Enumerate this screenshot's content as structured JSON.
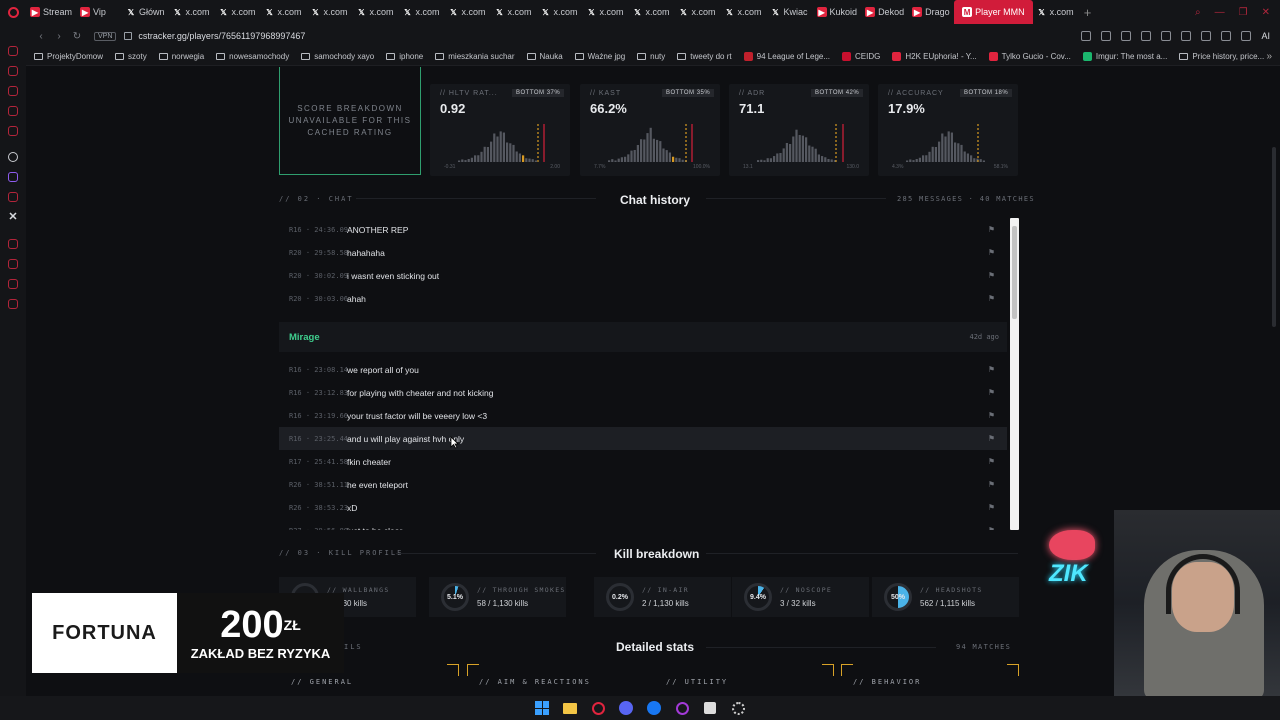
{
  "browser": {
    "tabs": [
      {
        "label": "Stream",
        "color": "#e0243e"
      },
      {
        "label": "Vip",
        "color": "#e0243e"
      },
      {
        "label": "Główn",
        "color": "#cccccc"
      },
      {
        "label": "x.com",
        "color": "#cccccc"
      },
      {
        "label": "x.com",
        "color": "#cccccc"
      },
      {
        "label": "x.com",
        "color": "#cccccc"
      },
      {
        "label": "x.com",
        "color": "#cccccc"
      },
      {
        "label": "x.com",
        "color": "#cccccc"
      },
      {
        "label": "x.com",
        "color": "#cccccc"
      },
      {
        "label": "x.com",
        "color": "#cccccc"
      },
      {
        "label": "x.com",
        "color": "#cccccc"
      },
      {
        "label": "x.com",
        "color": "#cccccc"
      },
      {
        "label": "x.com",
        "color": "#cccccc"
      },
      {
        "label": "x.com",
        "color": "#cccccc"
      },
      {
        "label": "x.com",
        "color": "#cccccc"
      },
      {
        "label": "x.com",
        "color": "#cccccc"
      },
      {
        "label": "Kwiac",
        "color": "#cccccc"
      },
      {
        "label": "Kukoid",
        "color": "#e0243e"
      },
      {
        "label": "Dekod",
        "color": "#e0243e"
      },
      {
        "label": "Drago",
        "color": "#e0243e"
      }
    ],
    "active_tab": "Player MMN",
    "trailing_tab": "x.com",
    "vpn_label": "VPN",
    "url": "cstracker.gg/players/76561197968997467",
    "ai_label": "AI",
    "bookmarks": [
      {
        "label": "ProjektyDomow",
        "kind": "folder"
      },
      {
        "label": "szoty",
        "kind": "folder"
      },
      {
        "label": "norwegia",
        "kind": "folder"
      },
      {
        "label": "nowesamochody",
        "kind": "folder"
      },
      {
        "label": "samochody xayo",
        "kind": "folder"
      },
      {
        "label": "iphone",
        "kind": "folder"
      },
      {
        "label": "mieszkania suchar",
        "kind": "folder"
      },
      {
        "label": "Nauka",
        "kind": "folder"
      },
      {
        "label": "Ważne jpg",
        "kind": "folder"
      },
      {
        "label": "nuty",
        "kind": "folder"
      },
      {
        "label": "tweety do rt",
        "kind": "folder"
      },
      {
        "label": "94 League of Lege...",
        "kind": "site",
        "color": "#c0202c"
      },
      {
        "label": "CEIDG",
        "kind": "site",
        "color": "#c8102e"
      },
      {
        "label": "H2K EUphoria! - Y...",
        "kind": "site",
        "color": "#e0243e"
      },
      {
        "label": "Tylko Gucio - Cov...",
        "kind": "site",
        "color": "#e0243e"
      },
      {
        "label": "Imgur: The most a...",
        "kind": "site",
        "color": "#1bb76e"
      },
      {
        "label": "Price history, price...",
        "kind": "doc"
      }
    ]
  },
  "score_box": {
    "text": "SCORE BREAKDOWN UNAVAILABLE FOR THIS CACHED RATING"
  },
  "stats": [
    {
      "label": "// HLTV RAT...",
      "badge": "BOTTOM 37%",
      "value": "0.92",
      "axis_min": "-0.31",
      "axis_max": "2.00"
    },
    {
      "label": "// KAST",
      "badge": "BOTTOM 35%",
      "value": "66.2%",
      "axis_min": "7.7%",
      "axis_max": "100.0%"
    },
    {
      "label": "// ADR",
      "badge": "BOTTOM 42%",
      "value": "71.1",
      "axis_min": "13.1",
      "axis_max": "130.0"
    },
    {
      "label": "// ACCURACY",
      "badge": "BOTTOM 18%",
      "value": "17.9%",
      "axis_min": "4.3%",
      "axis_max": "58.1%"
    }
  ],
  "chat": {
    "section_label": "// 02 · CHAT",
    "title": "Chat history",
    "summary": "285 MESSAGES · 40 MATCHES",
    "rows_before": [
      {
        "time": "R16 · 24:36.09",
        "msg": "ANOTHER REP"
      },
      {
        "time": "R20 · 29:58.58",
        "msg": "hahahaha"
      },
      {
        "time": "R20 · 30:02.09",
        "msg": "i wasnt even sticking out"
      },
      {
        "time": "R20 · 30:03.06",
        "msg": "ahah"
      }
    ],
    "map": {
      "name": "Mirage",
      "age": "42d ago"
    },
    "rows_after": [
      {
        "time": "R16 · 23:08.14",
        "msg": "we report all of you"
      },
      {
        "time": "R16 · 23:12.83",
        "msg": "for playing with cheater and not kicking"
      },
      {
        "time": "R16 · 23:19.66",
        "msg": "your trust factor will be veeery low <3"
      },
      {
        "time": "R16 · 23:25.44",
        "msg": "and u will play against hvh only"
      },
      {
        "time": "R17 · 25:41.58",
        "msg": "fkin cheater"
      },
      {
        "time": "R26 · 38:51.11",
        "msg": "he even teleport"
      },
      {
        "time": "R26 · 38:53.23",
        "msg": "xD"
      },
      {
        "time": "R27 · 39:56.80",
        "msg": "just to be clear"
      }
    ],
    "flag_glyph": "⚑"
  },
  "kill": {
    "section_label": "// 03 · KILL PROFILE",
    "title": "Kill breakdown",
    "cards": [
      {
        "label": "// WALLBANGS",
        "pct": "",
        "detail": "/ 1,130 kills",
        "fill": 0.0
      },
      {
        "label": "// THROUGH SMOKES",
        "pct": "5.1%",
        "detail": "58 / 1,130 kills",
        "fill": 0.051
      },
      {
        "label": "// IN-AIR",
        "pct": "0.2%",
        "detail": "2 / 1,130 kills",
        "fill": 0.002
      },
      {
        "label": "// NOSCOPE",
        "pct": "9.4%",
        "detail": "3 / 32 kills",
        "fill": 0.094
      },
      {
        "label": "// HEADSHOTS",
        "pct": "50%",
        "detail": "562 / 1,115 kills",
        "fill": 0.5
      }
    ]
  },
  "detailed": {
    "section_label": "ILS",
    "title": "Detailed stats",
    "summary": "94 MATCHES",
    "tabs": [
      "// GENERAL",
      "// AIM & REACTIONS",
      "// UTILITY",
      "// BEHAVIOR"
    ]
  },
  "ad": {
    "brand": "FORTUNA",
    "amount": "200",
    "currency": "ZŁ",
    "tagline": "ZAKŁAD BEZ RYZYKA"
  },
  "neon_sign": "ZIK"
}
